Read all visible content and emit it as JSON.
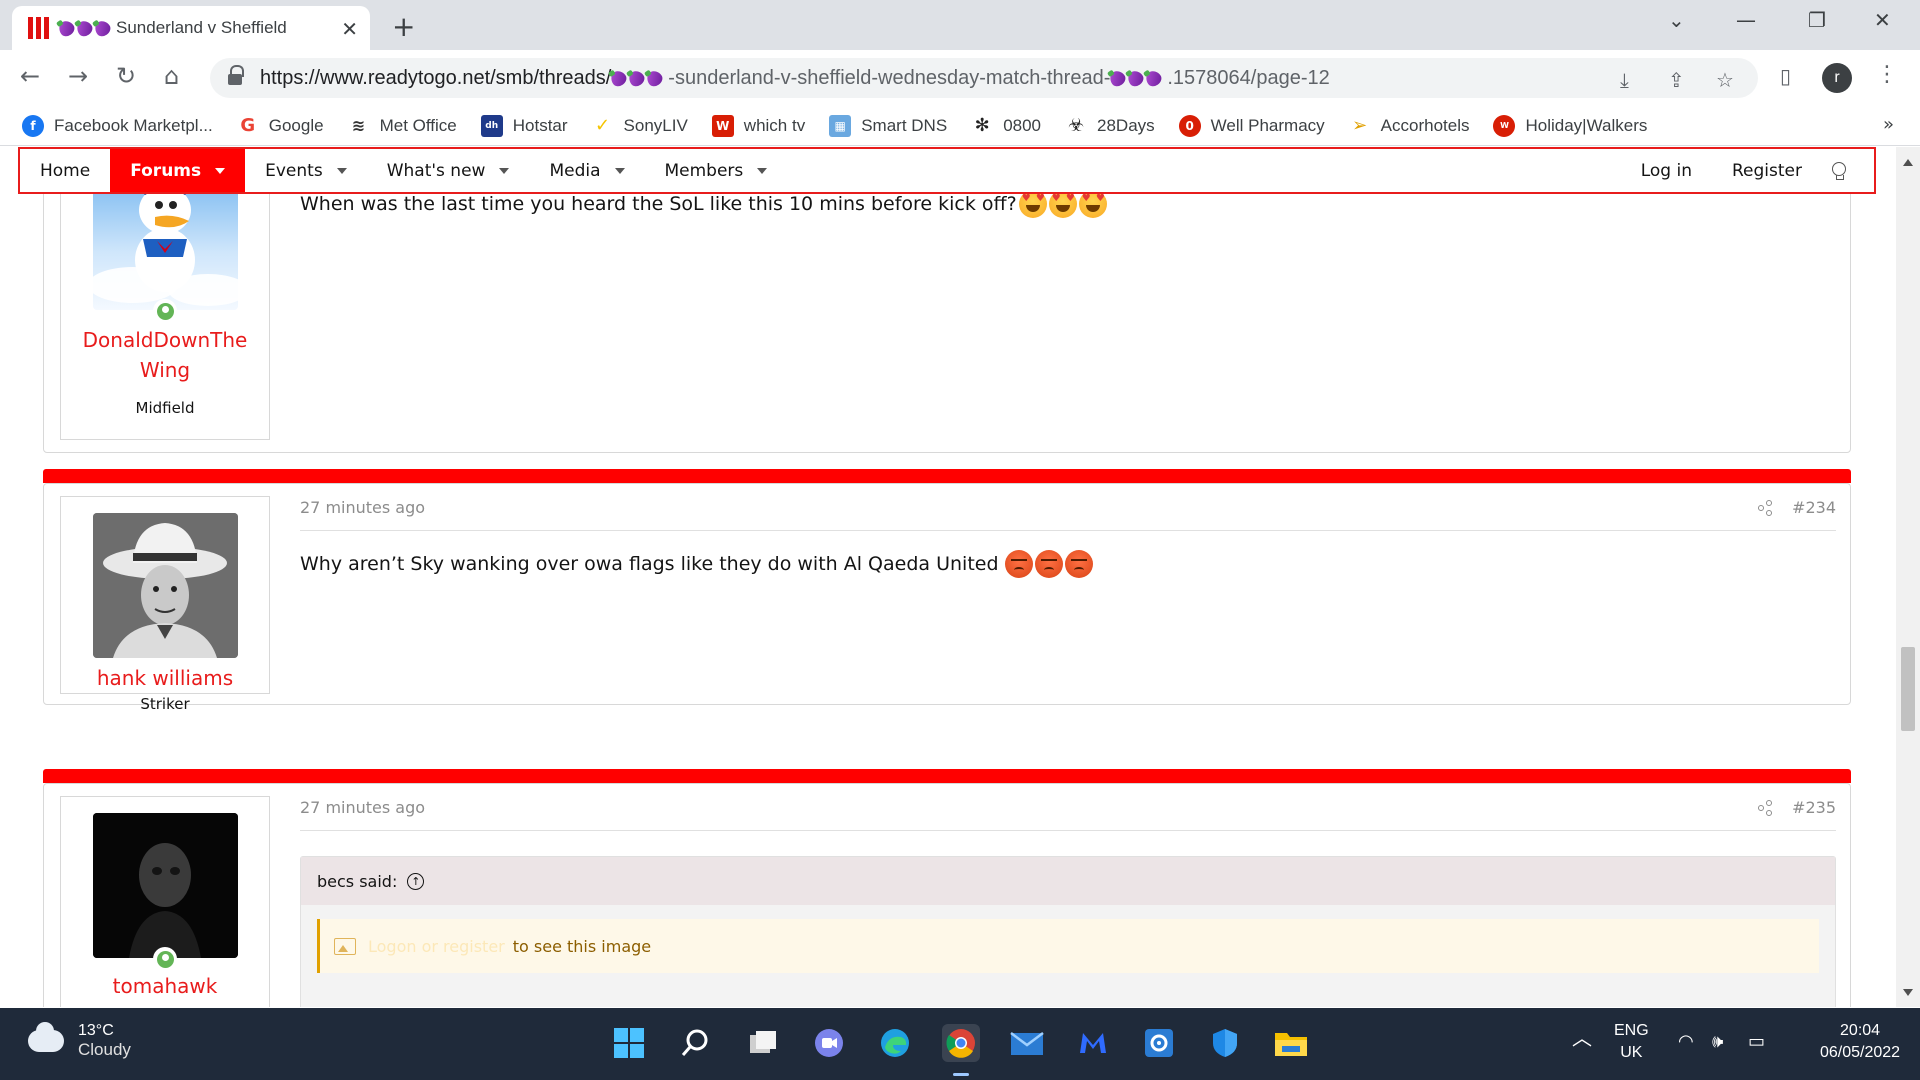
{
  "browser": {
    "tab_title": "Sunderland v Sheffield",
    "url_prefix": "https://www.readytogo.net/smb/threads/",
    "url_mid": "-sunderland-v-sheffield-wednesday-match-thread-",
    "url_suffix": ".1578064/page-12",
    "profile_initial": "r"
  },
  "bookmarks": [
    {
      "label": "Facebook Marketpl...",
      "icon": "facebook-icon",
      "color": "#1877f2"
    },
    {
      "label": "Google",
      "icon": "google-icon",
      "color": "#ea4335"
    },
    {
      "label": "Met Office",
      "icon": "met-office-icon",
      "color": "#333333"
    },
    {
      "label": "Hotstar",
      "icon": "hotstar-icon",
      "color": "#1f3a8a"
    },
    {
      "label": "SonyLIV",
      "icon": "sonyliv-icon",
      "color": "#f5c400"
    },
    {
      "label": "which tv",
      "icon": "which-tv-icon",
      "color": "#d81e05"
    },
    {
      "label": "Smart DNS",
      "icon": "smart-dns-icon",
      "color": "#f08c00"
    },
    {
      "label": "0800",
      "icon": "0800-icon",
      "color": "#222222"
    },
    {
      "label": "28Days",
      "icon": "28days-icon",
      "color": "#222222"
    },
    {
      "label": "Well Pharmacy",
      "icon": "well-pharmacy-icon",
      "color": "#d81e05"
    },
    {
      "label": "Accorhotels",
      "icon": "accorhotels-icon",
      "color": "#e0a000"
    },
    {
      "label": "Holiday|Walkers",
      "icon": "walkers-icon",
      "color": "#d81e05"
    }
  ],
  "nav": {
    "items": [
      {
        "label": "Home",
        "active": false,
        "dropdown": false
      },
      {
        "label": "Forums",
        "active": true,
        "dropdown": true
      },
      {
        "label": "Events",
        "active": false,
        "dropdown": true
      },
      {
        "label": "What's new",
        "active": false,
        "dropdown": true
      },
      {
        "label": "Media",
        "active": false,
        "dropdown": true
      },
      {
        "label": "Members",
        "active": false,
        "dropdown": true
      }
    ],
    "login": "Log in",
    "register": "Register",
    "accent": "#ff0000"
  },
  "posts": [
    {
      "username_line1": "DonaldDownThe",
      "username_line2": "Wing",
      "user_title": "Midfield",
      "body": "When was the last time you heard the SoL like this 10 mins before kick off?"
    },
    {
      "time": "27 minutes ago",
      "number": "#234",
      "username": "hank williams",
      "user_title": "Striker",
      "body": "Why aren’t Sky wanking over owa flags like they do with Al Qaeda United"
    },
    {
      "time": "27 minutes ago",
      "number": "#235",
      "username": "tomahawk",
      "quote_author": "becs said:",
      "image_notice_link": "Logon or register",
      "image_notice_text": "to see this image"
    }
  ],
  "taskbar": {
    "temperature": "13°C",
    "condition": "Cloudy",
    "language_line1": "ENG",
    "language_line2": "UK",
    "time": "20:04",
    "date": "06/05/2022"
  }
}
